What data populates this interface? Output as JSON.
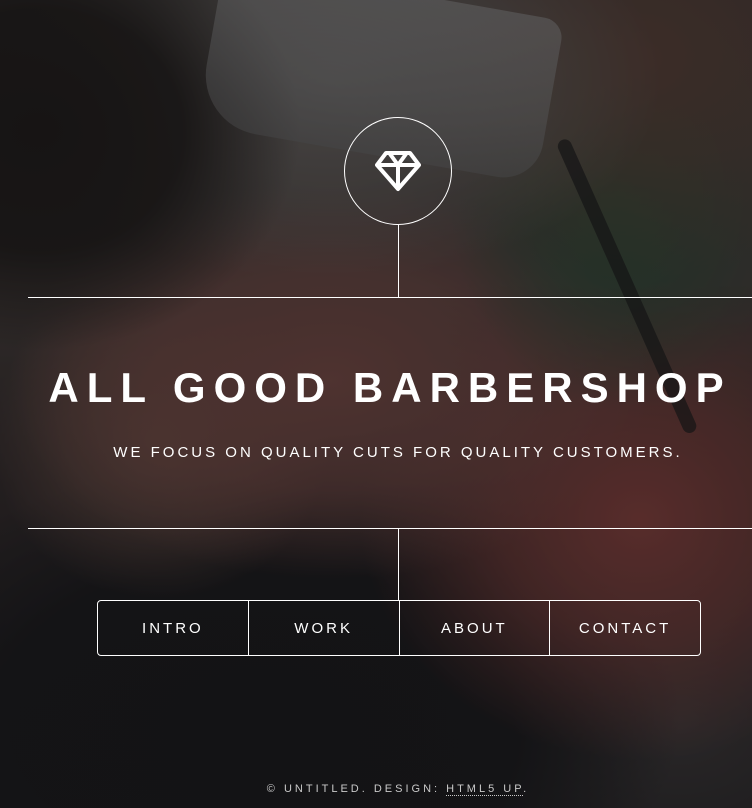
{
  "header": {
    "logo_icon": "diamond-icon"
  },
  "main": {
    "title": "ALL GOOD BARBERSHOP",
    "tagline": "WE FOCUS ON QUALITY CUTS FOR QUALITY CUSTOMERS."
  },
  "nav": {
    "items": [
      {
        "label": "INTRO"
      },
      {
        "label": "WORK"
      },
      {
        "label": "ABOUT"
      },
      {
        "label": "CONTACT"
      }
    ]
  },
  "footer": {
    "copyright": "© UNTITLED. DESIGN: ",
    "design_link": "HTML5 UP",
    "trailing": "."
  },
  "colors": {
    "text": "#ffffff",
    "overlay": "#1b1b1d"
  }
}
